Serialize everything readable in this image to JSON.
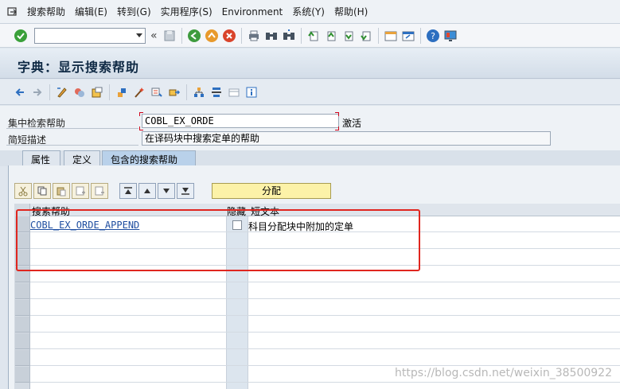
{
  "menu": {
    "items": [
      "搜索帮助",
      "编辑(E)",
      "转到(G)",
      "实用程序(S)",
      "Environment",
      "系统(Y)",
      "帮助(H)"
    ]
  },
  "toolbar": {
    "command_value": "",
    "back_glyph": "«"
  },
  "title": "字典：显示搜索帮助",
  "form": {
    "collective_label": "集中检索帮助",
    "collective_value": "COBL_EX_ORDE",
    "status": "激活",
    "desc_label": "简短描述",
    "desc_value": "在译码块中搜索定单的帮助"
  },
  "tabs": [
    {
      "label": "属性"
    },
    {
      "label": "定义"
    },
    {
      "label": "包含的搜索帮助"
    }
  ],
  "table": {
    "assign_label": "分配",
    "columns": [
      "搜索帮助",
      "隐藏",
      "短文本"
    ],
    "rows": [
      {
        "search_help": "COBL_EX_ORDE_APPEND",
        "hidden": false,
        "short_text": "科目分配块中附加的定单"
      }
    ]
  },
  "watermark": "https://blog.csdn.net/weixin_38500922",
  "colors": {
    "highlight_border": "#e0261f",
    "link": "#1f4ea0",
    "assign_button": "#fcf2a8"
  }
}
